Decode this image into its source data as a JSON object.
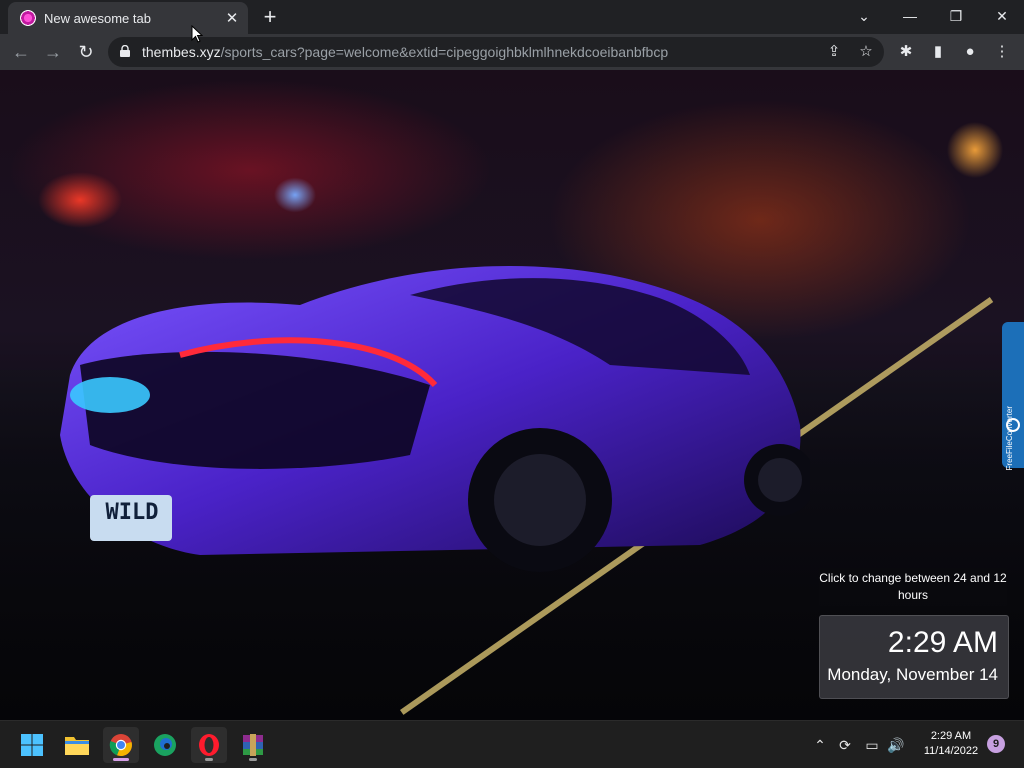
{
  "browser": {
    "tab_title": "New awesome tab",
    "tab_close": "✕",
    "new_tab": "+",
    "window_controls": {
      "tab_search": "⌄",
      "minimize": "—",
      "restore": "❐",
      "close": "✕"
    },
    "nav": {
      "back": "←",
      "forward": "→",
      "reload": "↻"
    },
    "url_host": "thembes.xyz",
    "url_path": "/sports_cars?page=welcome&extid=cipeggoighbklmlhnekdcoeibanbfbcp",
    "omnibox_icons": {
      "share": "⇪",
      "bookmark": "☆"
    },
    "toolbar_icons": {
      "extensions": "✱",
      "side_panel": "▮",
      "profile": "●",
      "menu": "⋮"
    }
  },
  "page": {
    "clock_hint": "Click to change between 24 and 12 hours",
    "clock_time": "2:29 AM",
    "clock_date": "Monday, November 14",
    "license_plate": "WILD",
    "side_tab_label": "FreeFileConverter"
  },
  "taskbar": {
    "apps": [
      "start",
      "file-explorer",
      "chrome",
      "edge",
      "opera",
      "winrar"
    ],
    "tray": {
      "chevron": "⌃",
      "sync": "⟳",
      "network": "▭",
      "volume": "🔊"
    },
    "time": "2:29 AM",
    "date": "11/14/2022",
    "notifications": "9"
  },
  "colors": {
    "tab_bg": "#35363a",
    "titlebar_bg": "#202124",
    "clock_box_bg": "#3c3c42",
    "taskbar_bg": "#1f1f1f",
    "car_purple": "#5a2fd8",
    "accent_blue": "#1c6fb8"
  }
}
